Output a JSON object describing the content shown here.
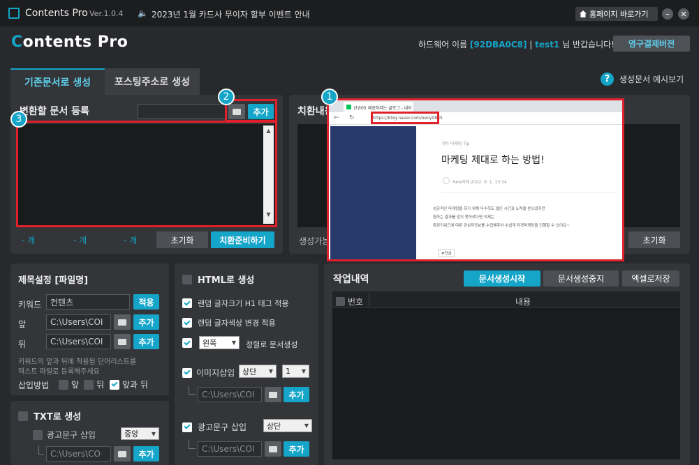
{
  "titlebar": {
    "app_name": "Contents Pro",
    "version": "Ver.1.0.4",
    "notice": "2023년 1월 카드사 무이자 할부 이벤트 안내",
    "homepage_label": "홈페이지 바로가기"
  },
  "header": {
    "logo": "Contents Pro",
    "hw_label": "하드웨어 이름",
    "hw_id": "[92DBA0C8]",
    "sep": "|",
    "user": "test1",
    "greeting": "님 반갑습니다!",
    "license_button": "영구결제버전"
  },
  "tabs": [
    "기존문서로 생성",
    "포스팅주소로 생성"
  ],
  "help_label": "생성문서 예시보기",
  "doc_register": {
    "title": "변환할 문서 등록",
    "add": "추가",
    "counts": [
      "- 개",
      "- 개",
      "- 개"
    ],
    "reset": "초기화",
    "prepare": "치환준비하기"
  },
  "replace_panel": {
    "title": "치환내용",
    "possible": "생성가능",
    "reset": "초기화"
  },
  "title_settings": {
    "title": "제목설정 [파일명]",
    "keyword_label": "키워드",
    "keyword_value": "컨텐츠",
    "apply": "적용",
    "front_label": "앞",
    "back_label": "뒤",
    "path_value": "C:\\Users\\COI",
    "add": "추가",
    "hint1": "키워드의 앞과 뒤에 적용될 단어리스트를",
    "hint2": "텍스트 파일로 등록해주세요",
    "insert_method": "삽입방법",
    "opt_front": "앞",
    "opt_back": "뒤",
    "opt_both": "앞과 뒤"
  },
  "txt_section": {
    "title": "TXT로 생성",
    "ad_insert": "광고문구 삽입",
    "ad_pos": "중앙",
    "path_value": "C:\\Users\\CO",
    "add": "추가"
  },
  "html_section": {
    "title": "HTML로 생성",
    "opt_h1": "랜덤 글자크기 H1 태그 적용",
    "opt_color": "랜덤 글자색상 변경 적용",
    "align_value": "왼쪽",
    "align_suffix": "정렬로 문서생성",
    "img_insert": "이미지삽입",
    "img_pos": "상단",
    "img_count": "1",
    "path_value": "C:\\Users\\COI",
    "add": "추가",
    "ad_insert": "광고문구 삽입",
    "ad_pos": "상단"
  },
  "work": {
    "title": "작업내역",
    "start": "문서생성시작",
    "stop": "문서생성중지",
    "excel": "엑셀로저장",
    "col_no": "번호",
    "col_content": "내용"
  },
  "preview": {
    "tab_title": "신규05 제공하지는 글로그 - 네이",
    "url": "https://blog.naver.com/eeny0885",
    "category": "기타 마케팅 Tip",
    "post_title": "마케팅 제대로 하는 방법!",
    "author": "New마케 2022. 9. 1. 13:34",
    "body1": "성공적인 마케팅을 하기 위해 무수히도 많은 시간과 노력을 쏟으셨지만",
    "body2": "원하는 결과를 얻지 못하셨다면 이제는",
    "body3": "특정키워드에 따른 관심자정보를 수집해주어 손쉽게 타겟마케팅을 진행할 수 있어요~",
    "tag": "#전글"
  },
  "badges": [
    "1",
    "2",
    "3"
  ],
  "colors": {
    "accent": "#14a5c9",
    "annotation": "#e0202a",
    "background": "#27292c"
  }
}
